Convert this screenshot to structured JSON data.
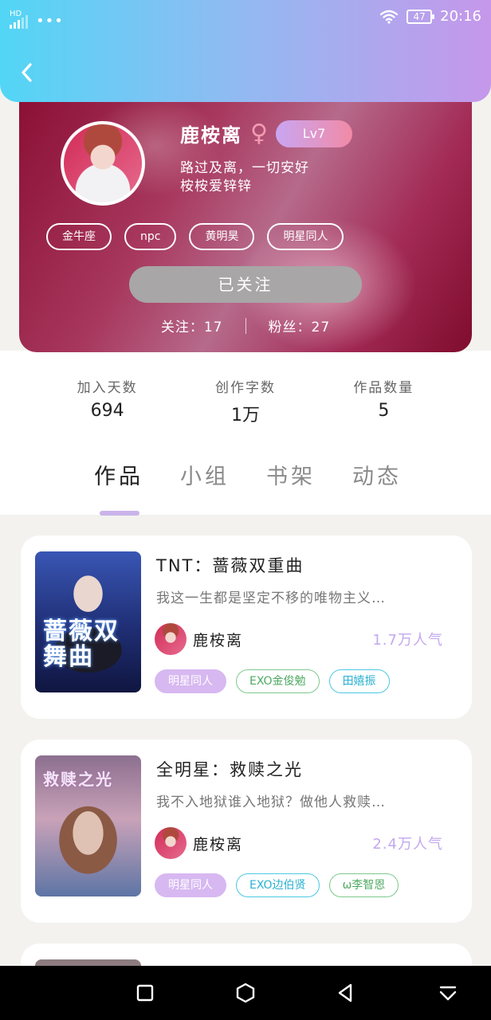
{
  "status_bar": {
    "hd": "HD",
    "dots": "•••",
    "battery": "47",
    "time": "20:16"
  },
  "profile": {
    "name": "鹿桉离",
    "gender_symbol": "♀",
    "level": "Lv7",
    "bio_line1": "路过及离，一切安好",
    "bio_line2": "桉桉爱锌锌",
    "tags": [
      "金牛座",
      "npc",
      "黄明昊",
      "明星同人"
    ],
    "follow_button": "已关注",
    "following": "关注：17",
    "fans": "粉丝：27"
  },
  "stats": [
    {
      "label": "加入天数",
      "value": "694"
    },
    {
      "label": "创作字数",
      "value": "1万"
    },
    {
      "label": "作品数量",
      "value": "5"
    }
  ],
  "tabs": [
    "作品",
    "小组",
    "书架",
    "动态"
  ],
  "books": [
    {
      "title": "TNT：蔷薇双重曲",
      "description": "我这一生都是坚定不移的唯物主义…",
      "cover_text": "蔷薇双舞曲",
      "author": "鹿桉离",
      "popularity": "1.7万人气",
      "tags": [
        "明星同人",
        "EXO金俊勉",
        "田嬉振"
      ]
    },
    {
      "title": "全明星：救赎之光",
      "description": "我不入地狱谁入地狱？做他人救赎…",
      "cover_text": "救赎之光",
      "author": "鹿桉离",
      "popularity": "2.4万人气",
      "tags": [
        "明星同人",
        "EXO边伯贤",
        "ω李智恩"
      ]
    }
  ],
  "icons": {
    "back": "chevron-left-icon",
    "wifi": "wifi-icon",
    "nav": [
      "square-icon",
      "hexagon-icon",
      "triangle-back-icon",
      "download-icon"
    ]
  },
  "colors": {
    "header_start": "#52d6f5",
    "header_end": "#c697ea",
    "accent_purple": "#c9b3ea",
    "popularity": "#c3a8ee"
  }
}
